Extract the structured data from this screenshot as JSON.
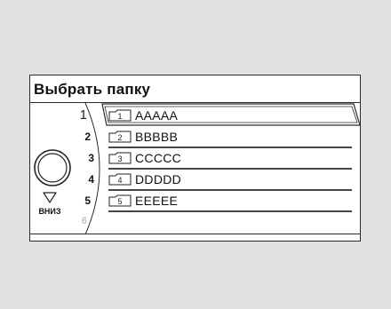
{
  "screen": {
    "title": "Выбрать папку",
    "down_label": "ВНИЗ"
  },
  "list": {
    "numbers": [
      "1",
      "2",
      "3",
      "4",
      "5",
      "6"
    ],
    "selected_index": 0,
    "items": [
      {
        "number": "1",
        "label": "AAAAA"
      },
      {
        "number": "2",
        "label": "BBBBB"
      },
      {
        "number": "3",
        "label": "CCCCC"
      },
      {
        "number": "4",
        "label": "DDDDD"
      },
      {
        "number": "5",
        "label": "EEEEE"
      }
    ]
  },
  "colors": {
    "background": "#e2e2e2",
    "screen": "#ffffff",
    "ink": "#111111",
    "faded_number": "#c4c4c4"
  },
  "icons": {
    "folder": "folder-icon",
    "knob": "rotary-knob-icon",
    "down": "down-arrow-icon"
  }
}
